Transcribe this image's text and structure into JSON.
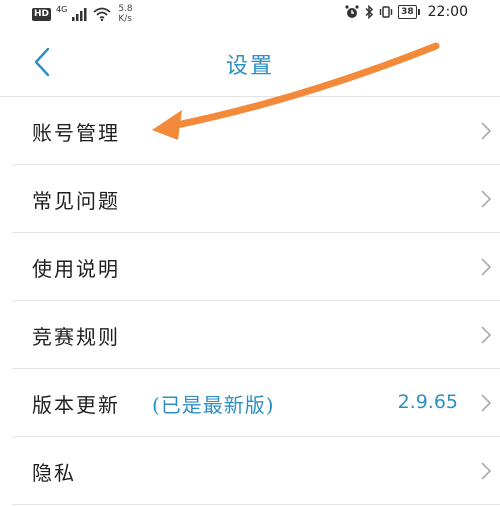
{
  "status_bar": {
    "hd": "HD",
    "network": "4G",
    "speed_value": "5.8",
    "speed_unit": "K/s",
    "battery": "38",
    "battery_level": 0.38,
    "time": "22:00"
  },
  "header": {
    "title": "设置"
  },
  "settings": {
    "items": [
      {
        "label": "账号管理"
      },
      {
        "label": "常见问题"
      },
      {
        "label": "使用说明"
      },
      {
        "label": "竞赛规则"
      },
      {
        "label": "版本更新",
        "note": "(已是最新版)",
        "value": "2.9.65"
      },
      {
        "label": "隐私"
      }
    ]
  },
  "colors": {
    "accent": "#2e8fc4",
    "annotation_arrow": "#f28a3a"
  }
}
